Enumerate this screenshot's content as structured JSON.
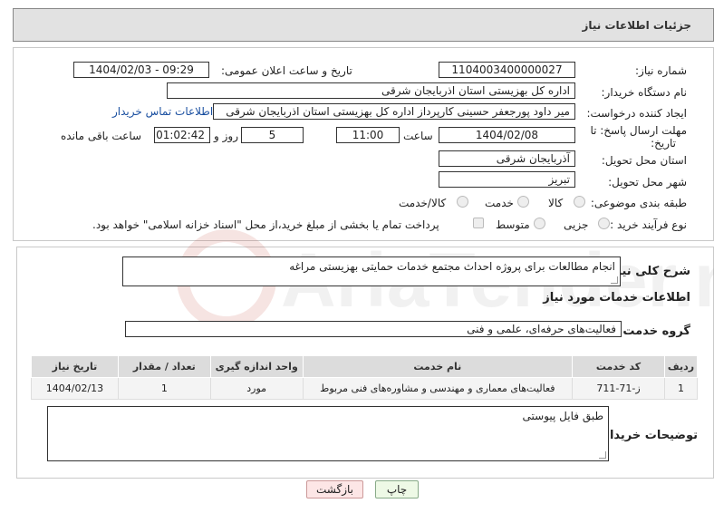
{
  "header": {
    "title": "جزئیات اطلاعات نیاز"
  },
  "form": {
    "need_number_label": "شماره نیاز:",
    "need_number": "1104003400000027",
    "announce_label": "تاریخ و ساعت اعلان عمومی:",
    "announce_value": "1404/02/03 - 09:29",
    "buyer_org_label": "نام دستگاه خریدار:",
    "buyer_org": "اداره کل بهزیستی استان اذربایجان شرقی",
    "creator_label": "ایجاد کننده درخواست:",
    "creator": "میر داود پورجعفر حسینی کارپرداز اداره کل بهزیستی استان اذربایجان شرقی",
    "contact_link": "اطلاعات تماس خریدار",
    "deadline_label_1": "مهلت ارسال پاسخ: تا",
    "deadline_label_2": "تاریخ:",
    "deadline_date": "1404/02/08",
    "time_label": "ساعت",
    "deadline_time": "11:00",
    "days_value": "5",
    "days_label": "روز و",
    "remaining_time": "01:02:42",
    "remaining_label": "ساعت باقی مانده",
    "province_label": "استان محل تحویل:",
    "province": "آذربایجان شرقی",
    "city_label": "شهر محل تحویل:",
    "city": "تبریز",
    "category_label": "طبقه بندی موضوعی:",
    "category_options": [
      "کالا",
      "خدمت",
      "کالا/خدمت"
    ],
    "process_label": "نوع فرآیند خرید :",
    "process_options": [
      "جزیی",
      "متوسط"
    ],
    "payment_note": "پرداخت تمام یا بخشی از مبلغ خرید،از محل \"اسناد خزانه اسلامی\" خواهد بود."
  },
  "description": {
    "label": "شرح کلی نیاز:",
    "text": "انجام مطالعات برای پروژه احداث مجتمع خدمات حمایتی بهزیستی مراغه"
  },
  "services": {
    "section_title": "اطلاعات خدمات مورد نیاز",
    "group_label": "گروه خدمت:",
    "group_value": "فعالیت‌های حرفه‌ای، علمی و فنی",
    "columns": [
      "ردیف",
      "کد خدمت",
      "نام خدمت",
      "واحد اندازه گیری",
      "تعداد / مقدار",
      "تاریخ نیاز"
    ],
    "rows": [
      [
        "1",
        "ز-71-711",
        "فعالیت‌های معماری و مهندسی و مشاوره‌های فنی مربوط",
        "مورد",
        "1",
        "1404/02/13"
      ]
    ]
  },
  "buyer_notes": {
    "label": "توضیحات خریدار:",
    "text": "طبق فایل پیوستی"
  },
  "buttons": {
    "print": "چاپ",
    "back": "بازگشت"
  },
  "watermark": {
    "text": "AriaTender.neT"
  }
}
